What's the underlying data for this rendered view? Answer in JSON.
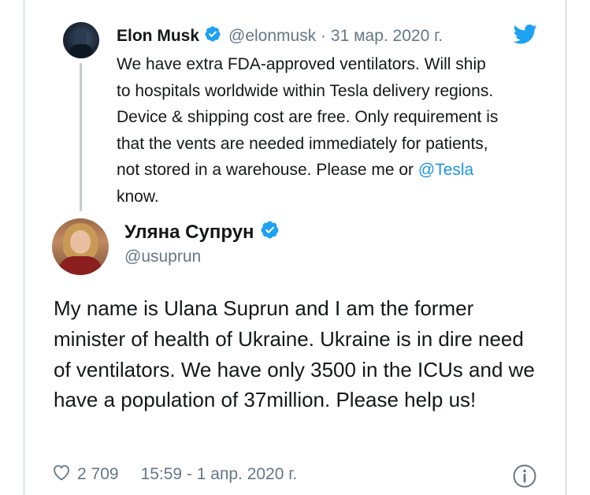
{
  "quoted_tweet": {
    "name": "Elon Musk",
    "handle": "@elonmusk",
    "separator": " · ",
    "date": "31 мар. 2020 г.",
    "text_before": "We have extra FDA-approved ventilators. Will ship to hospitals worldwide within Tesla delivery regions. Device & shipping cost are free. Only requirement is that the vents are needed immediately for patients, not stored in a warehouse. Please me or ",
    "mention": "@Tesla",
    "text_after": " know."
  },
  "main_tweet": {
    "name": "Уляна Супрун",
    "handle": "@usuprun",
    "text": "My name is Ulana Suprun and I am the former minister of health of Ukraine. Ukraine is in dire need of ventilators. We have only 3500 in the ICUs and we have a population of  37million. Please help us!",
    "likes": "2 709",
    "timestamp": "15:59 - 1 апр. 2020 г."
  },
  "colors": {
    "accent": "#1da1f2",
    "link": "#1b95e0",
    "secondary_text": "#657786",
    "primary_text": "#14171a"
  },
  "icons": [
    "verified-badge-icon",
    "twitter-bird-icon",
    "heart-icon",
    "info-icon"
  ]
}
